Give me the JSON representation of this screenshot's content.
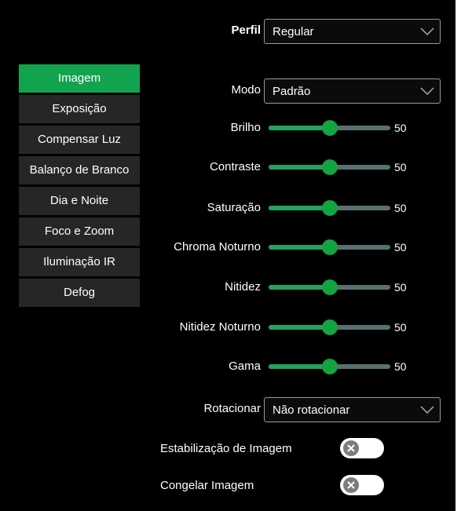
{
  "profile": {
    "label": "Perfil",
    "value": "Regular"
  },
  "sidebar": {
    "items": [
      {
        "label": "Imagem",
        "active": true
      },
      {
        "label": "Exposição",
        "active": false
      },
      {
        "label": "Compensar Luz",
        "active": false
      },
      {
        "label": "Balanço de Branco",
        "active": false
      },
      {
        "label": "Dia e Noite",
        "active": false
      },
      {
        "label": "Foco e Zoom",
        "active": false
      },
      {
        "label": "Iluminação IR",
        "active": false
      },
      {
        "label": "Defog",
        "active": false
      }
    ]
  },
  "mode": {
    "label": "Modo",
    "value": "Padrão"
  },
  "sliders": [
    {
      "label": "Brilho",
      "value": "50"
    },
    {
      "label": "Contraste",
      "value": "50"
    },
    {
      "label": "Saturação",
      "value": "50"
    },
    {
      "label": "Chroma Noturno",
      "value": "50"
    },
    {
      "label": "Nitidez",
      "value": "50"
    },
    {
      "label": "Nitidez Noturno",
      "value": "50"
    },
    {
      "label": "Gama",
      "value": "50"
    }
  ],
  "slider_range": {
    "min": 0,
    "max": 100
  },
  "rotate": {
    "label": "Rotacionar",
    "value": "Não rotacionar"
  },
  "toggles": [
    {
      "label": "Estabilização de Imagem",
      "on": false
    },
    {
      "label": "Congelar Imagem",
      "on": false
    }
  ],
  "colors": {
    "background": "#000000",
    "accent": "#13a341",
    "sidebar_item": "#262626",
    "track": "#587070",
    "toggle_off": "#ffffff",
    "toggle_knob": "#7d7d7d"
  },
  "icons": {
    "dropdown": "chevron-down-icon",
    "toggle_off": "close-icon"
  }
}
